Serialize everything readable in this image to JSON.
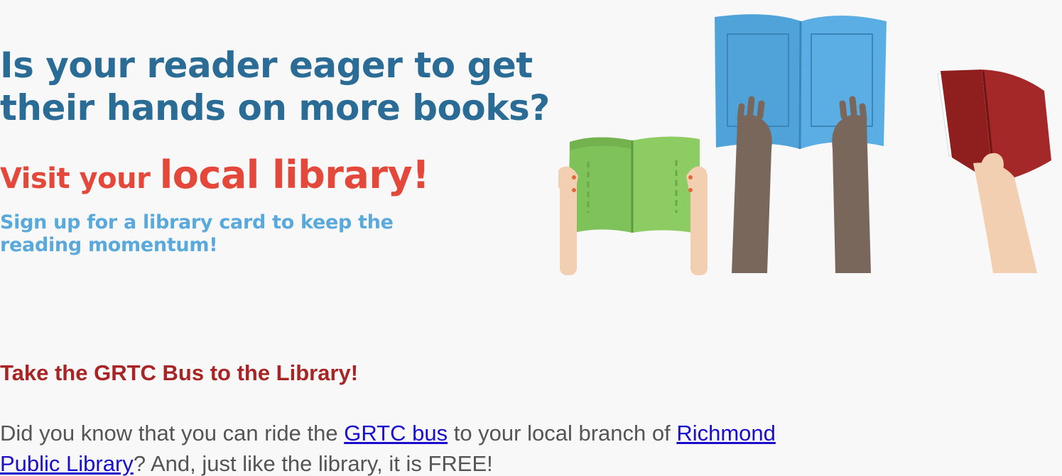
{
  "hero": {
    "headline_line1": "Is your reader eager to get",
    "headline_line2": "their hands on more books?",
    "cta_prefix": "Visit your ",
    "cta_emphasis": "local library!",
    "sub_line1": "Sign up for a library card to keep the",
    "sub_line2": "reading momentum!",
    "illustration_icon": "hands-holding-books-illustration"
  },
  "article": {
    "title": "Take the GRTC Bus to the Library!",
    "p1_before": "Did you know that you can ride the ",
    "p1_link1": "GRTC bus",
    "p1_middle": " to your local branch of ",
    "p1_link2_line1": "Richmond",
    "p1_link2_line2": "Public Library",
    "p1_after": "? And, just like the library, it is FREE!"
  },
  "colors": {
    "headline": "#2a6c95",
    "cta": "#e3483a",
    "subline": "#5aa9dc",
    "title": "#a82525",
    "link": "#1a0dcc",
    "text": "#555555",
    "background": "#f8f8f8"
  }
}
